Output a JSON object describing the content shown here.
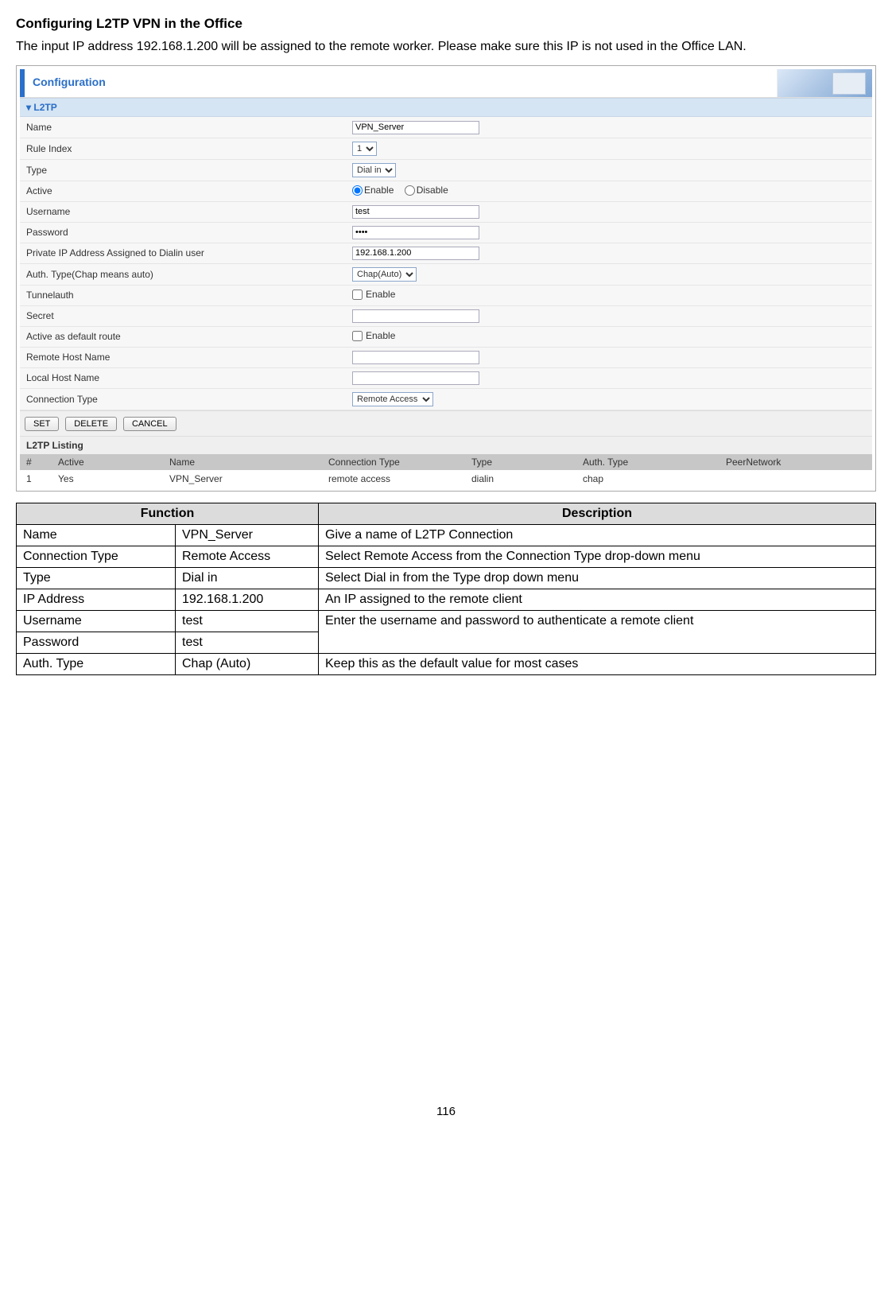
{
  "page": {
    "title": "Configuring L2TP VPN in the Office",
    "intro": "The input IP address 192.168.1.200 will be assigned to the remote worker. Please make sure this IP is not used in the Office LAN.",
    "number": "116"
  },
  "config": {
    "header": "Configuration",
    "section": "L2TP",
    "fields": {
      "name_label": "Name",
      "name_value": "VPN_Server",
      "rule_index_label": "Rule Index",
      "rule_index_value": "1",
      "type_label": "Type",
      "type_value": "Dial in",
      "active_label": "Active",
      "active_enable": "Enable",
      "active_disable": "Disable",
      "username_label": "Username",
      "username_value": "test",
      "password_label": "Password",
      "password_value": "••••",
      "private_ip_label": "Private IP Address Assigned to Dialin user",
      "private_ip_value": "192.168.1.200",
      "auth_type_label": "Auth. Type(Chap means auto)",
      "auth_type_value": "Chap(Auto)",
      "tunnelauth_label": "Tunnelauth",
      "tunnelauth_enable": "Enable",
      "secret_label": "Secret",
      "secret_value": "",
      "default_route_label": "Active as default route",
      "default_route_enable": "Enable",
      "remote_host_label": "Remote Host Name",
      "remote_host_value": "",
      "local_host_label": "Local Host Name",
      "local_host_value": "",
      "conn_type_label": "Connection Type",
      "conn_type_value": "Remote Access"
    },
    "buttons": {
      "set": "SET",
      "delete": "DELETE",
      "cancel": "CANCEL"
    },
    "listing": {
      "title": "L2TP Listing",
      "headers": {
        "num": "#",
        "active": "Active",
        "name": "Name",
        "conn_type": "Connection Type",
        "type": "Type",
        "auth_type": "Auth. Type",
        "peer": "PeerNetwork"
      },
      "row1": {
        "num": "1",
        "active": "Yes",
        "name": "VPN_Server",
        "conn_type": "remote access",
        "type": "dialin",
        "auth_type": "chap",
        "peer": ""
      }
    }
  },
  "desc": {
    "header_function": "Function",
    "header_description": "Description",
    "rows": {
      "name_f": "Name",
      "name_v": "VPN_Server",
      "name_d": "Give a name of L2TP Connection",
      "conn_f": "Connection Type",
      "conn_v": "Remote Access",
      "conn_d": "Select Remote Access from the Connection Type drop-down menu",
      "type_f": "Type",
      "type_v": "Dial in",
      "type_d": "Select Dial in from the Type drop down menu",
      "ip_f": "IP Address",
      "ip_v": "192.168.1.200",
      "ip_d": "An IP assigned to the remote client",
      "user_f": "Username",
      "user_v": "test",
      "pass_f": "Password",
      "pass_v": "test",
      "userpass_d": "Enter the username and password to authenticate a remote client",
      "auth_f": "Auth. Type",
      "auth_v": "Chap (Auto)",
      "auth_d": "Keep this as the default value for most cases"
    }
  }
}
